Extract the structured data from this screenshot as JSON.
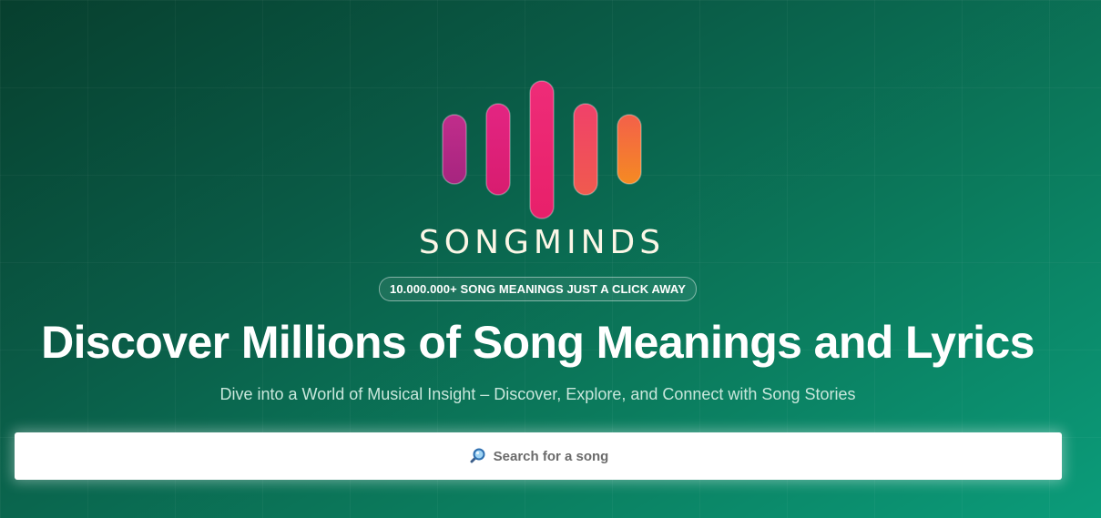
{
  "brand": {
    "name": "SONGMINDS",
    "logo_colors": [
      "#b02a85",
      "#e01f74",
      "#ea2470",
      "#f04f5a",
      "#f4792b"
    ]
  },
  "hero": {
    "badge": "10.000.000+ SONG MEANINGS JUST A CLICK AWAY",
    "headline": "Discover Millions of Song Meanings and Lyrics",
    "subheadline": "Dive into a World of Musical Insight – Discover, Explore, and Connect with Song Stories"
  },
  "search": {
    "placeholder": "Search for a song",
    "icon": "magnifying-glass-icon"
  },
  "theme": {
    "background_start": "#073f2e",
    "background_end": "#0b9c7a",
    "search_background": "#ffffff"
  }
}
